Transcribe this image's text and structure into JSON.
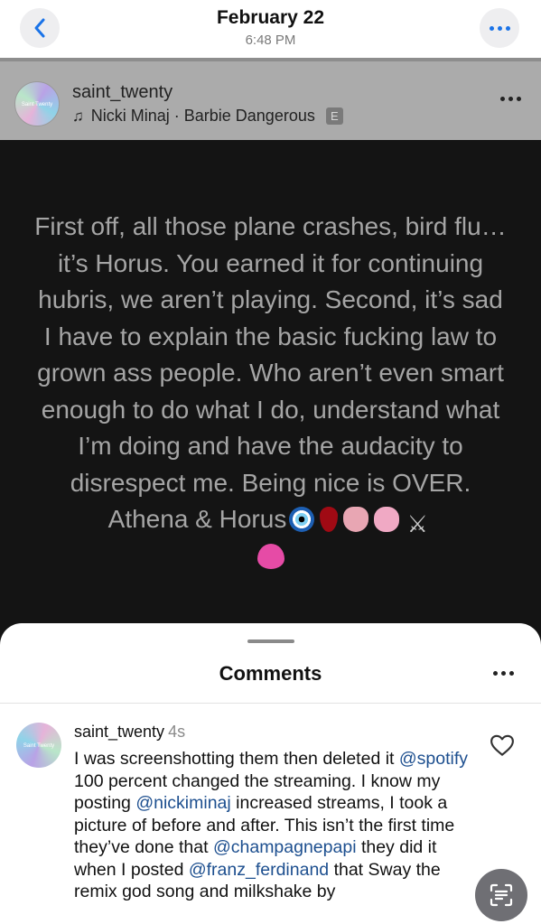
{
  "nav": {
    "date": "February 22",
    "time": "6:48 PM"
  },
  "story": {
    "username": "saint_twenty",
    "avatar_text": "Saint Twenty",
    "music": "Nicki Minaj · Barbie Dangerous",
    "explicit_badge": "E",
    "text": "First off, all those plane crashes, bird flu…it’s Horus. You earned it for continuing hubris, we aren’t playing. Second, it’s sad I have to explain the basic fucking law to grown ass people. Who aren’t even smart enough to do what I do, understand what I’m doing and have the audacity to disrespect me. Being nice is OVER. Athena & Horus",
    "swords_emoji": "⚔"
  },
  "comments": {
    "title": "Comments",
    "items": [
      {
        "username": "saint_twenty",
        "avatar_text": "Saint Twenty",
        "time": "4s",
        "parts": [
          "I was screenshotting them then deleted it ",
          "@spotify",
          " 100 percent changed the streaming. I know my posting ",
          "@nickiminaj",
          " increased streams, I took a picture of before and after. This isn’t the first time they’ve done that ",
          "@champagnepapi",
          " they did it when  I posted ",
          "@franz_ferdinand",
          " that Sway the remix god song and milkshake by"
        ]
      }
    ]
  },
  "colors": {
    "accent_blue": "#1a73e8",
    "mention_blue": "#1d4f8f",
    "story_background": "#141414",
    "story_text": "#a5a5a5"
  },
  "icons": [
    "chevron-left-icon",
    "more-horizontal-icon",
    "music-note-icon",
    "explicit-icon",
    "heart-outline-icon",
    "scan-text-icon"
  ]
}
